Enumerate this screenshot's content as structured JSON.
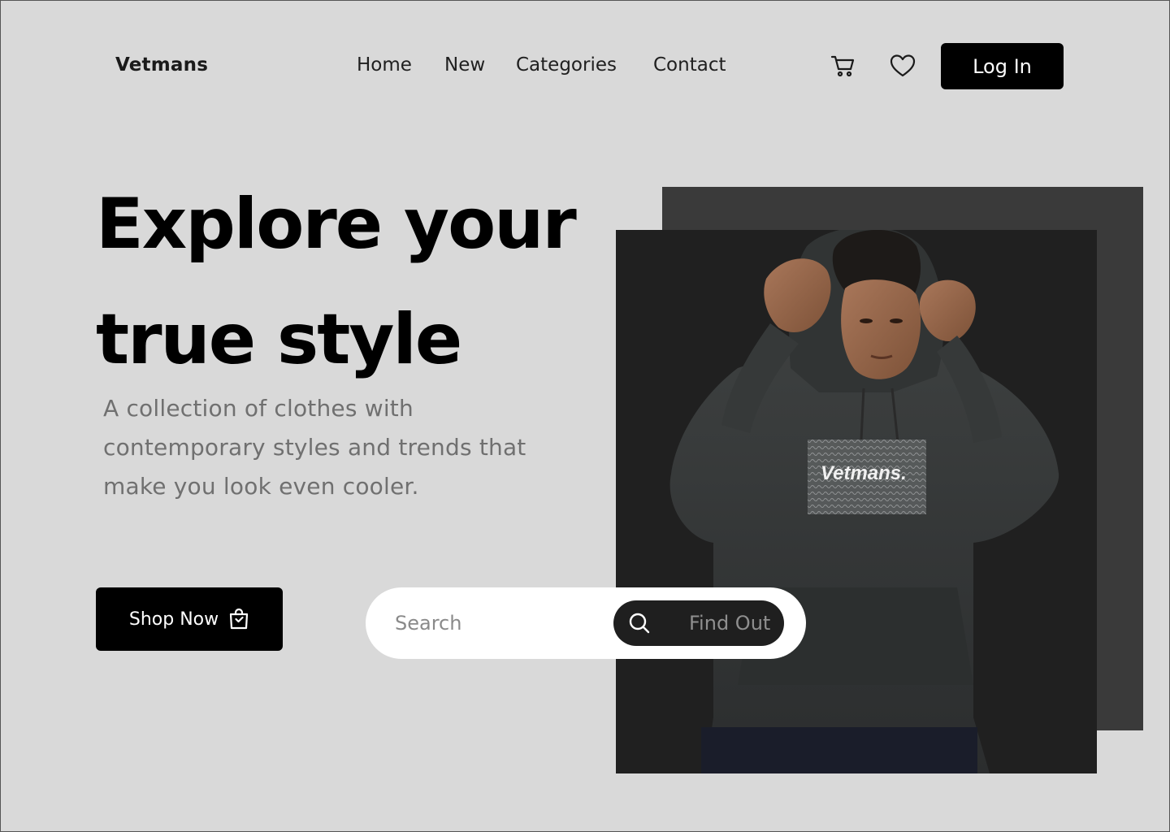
{
  "brand": {
    "name": "Vetmans"
  },
  "nav": {
    "links": [
      {
        "label": "Home"
      },
      {
        "label": "New"
      },
      {
        "label": "Categories"
      },
      {
        "label": "Contact"
      }
    ]
  },
  "header": {
    "cart_icon": "cart-icon",
    "favorites_icon": "heart-icon",
    "login_label": "Log In"
  },
  "hero": {
    "headline_line1": "Explore your",
    "headline_line2": "true style",
    "subtitle": "A collection of clothes with contemporary styles and trends that make you look even cooler.",
    "shop_label": "Shop Now",
    "shop_icon": "shopping-bag-icon",
    "hoodie_print": "Vetmans."
  },
  "search": {
    "placeholder": "Search",
    "value": "",
    "button_label": "Find Out",
    "button_icon": "search-icon"
  },
  "colors": {
    "background": "#d9d9d9",
    "primary": "#000000",
    "muted_text": "#707070",
    "photo_back": "#3a3a3a",
    "photo_front": "#202020"
  }
}
